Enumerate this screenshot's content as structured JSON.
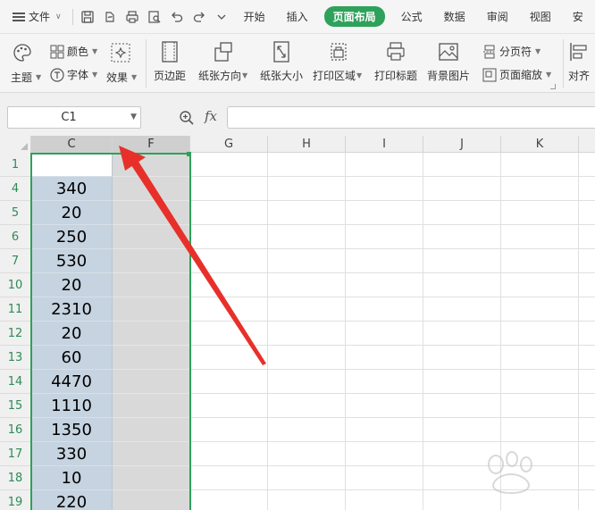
{
  "menubar": {
    "file_label": "文件",
    "tabs": [
      {
        "label": "开始",
        "active": false
      },
      {
        "label": "插入",
        "active": false
      },
      {
        "label": "页面布局",
        "active": true
      },
      {
        "label": "公式",
        "active": false
      },
      {
        "label": "数据",
        "active": false
      },
      {
        "label": "审阅",
        "active": false
      },
      {
        "label": "视图",
        "active": false
      },
      {
        "label": "安",
        "active": false
      }
    ]
  },
  "ribbon": {
    "theme_label": "主题",
    "color_label": "颜色",
    "font_label": "字体",
    "effect_label": "效果",
    "margins_label": "页边距",
    "orientation_label": "纸张方向",
    "size_label": "纸张大小",
    "print_area_label": "打印区域",
    "print_titles_label": "打印标题",
    "background_label": "背景图片",
    "page_break_label": "分页符",
    "scale_label": "页面缩放",
    "align_label": "对齐"
  },
  "formula_bar": {
    "name_box": "C1",
    "fx_label": "fx",
    "formula": ""
  },
  "sheet": {
    "columns": [
      "C",
      "F",
      "G",
      "H",
      "I",
      "J",
      "K"
    ],
    "rows": [
      {
        "num": "1",
        "c": ""
      },
      {
        "num": "4",
        "c": "340"
      },
      {
        "num": "5",
        "c": "20"
      },
      {
        "num": "6",
        "c": "250"
      },
      {
        "num": "7",
        "c": "530"
      },
      {
        "num": "10",
        "c": "20"
      },
      {
        "num": "11",
        "c": "2310"
      },
      {
        "num": "12",
        "c": "20"
      },
      {
        "num": "13",
        "c": "60"
      },
      {
        "num": "14",
        "c": "4470"
      },
      {
        "num": "15",
        "c": "1110"
      },
      {
        "num": "16",
        "c": "1350"
      },
      {
        "num": "17",
        "c": "330"
      },
      {
        "num": "18",
        "c": "10"
      },
      {
        "num": "19",
        "c": "220"
      }
    ]
  },
  "colors": {
    "accent_green": "#2ea15a",
    "selected_cell_blue": "#c6d3e0",
    "annotation_red": "#e8302a"
  }
}
